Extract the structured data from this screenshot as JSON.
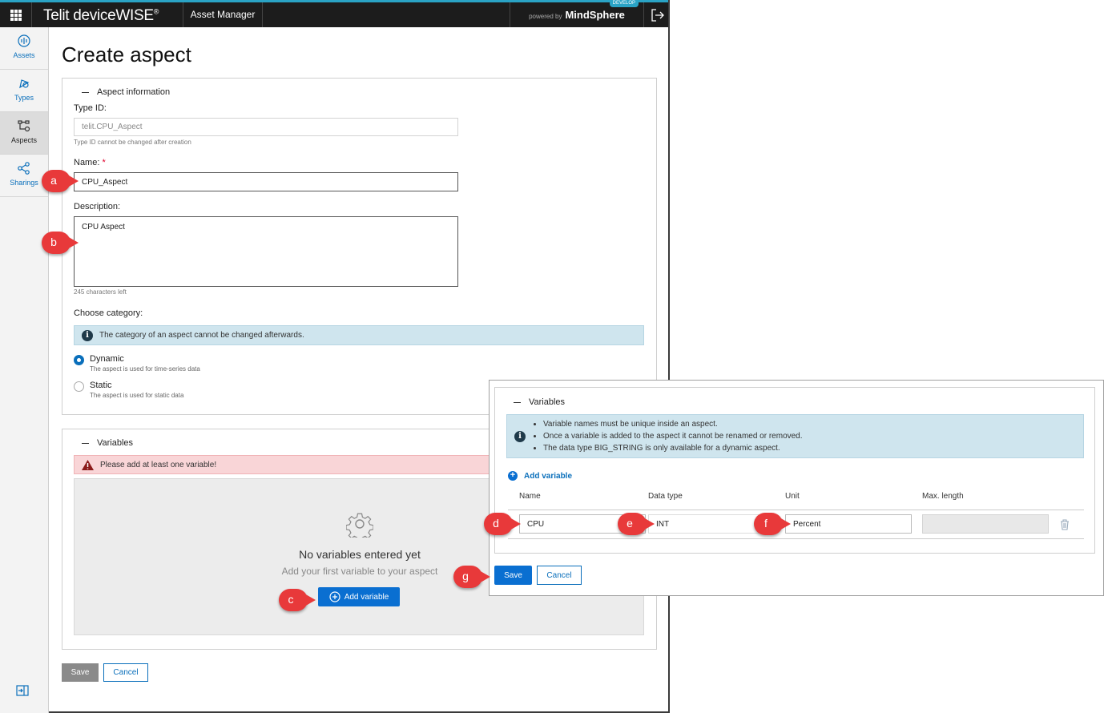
{
  "header": {
    "brand": "Telit deviceWISE",
    "app_name": "Asset Manager",
    "powered_by": "powered by",
    "platform": "MindSphere",
    "env_badge": "DEVELOP"
  },
  "sidebar": {
    "items": [
      {
        "label": "Assets",
        "icon": "assets-icon"
      },
      {
        "label": "Types",
        "icon": "types-icon"
      },
      {
        "label": "Aspects",
        "icon": "aspects-icon",
        "active": true
      },
      {
        "label": "Sharings",
        "icon": "sharings-icon"
      }
    ]
  },
  "page": {
    "title": "Create aspect"
  },
  "aspect_info": {
    "section_title": "Aspect information",
    "type_id_label": "Type ID:",
    "type_id_value": "telit.CPU_Aspect",
    "type_id_hint": "Type ID cannot be changed after creation",
    "name_label": "Name:",
    "name_required": "*",
    "name_value": "CPU_Aspect",
    "description_label": "Description:",
    "description_value": "CPU Aspect",
    "chars_left": "245 characters left",
    "category_label": "Choose category:",
    "category_info": "The category of an aspect cannot be changed afterwards.",
    "options": [
      {
        "label": "Dynamic",
        "desc": "The aspect is used for time-series data",
        "selected": true
      },
      {
        "label": "Static",
        "desc": "The aspect is used for static data",
        "selected": false
      }
    ]
  },
  "variables": {
    "section_title": "Variables",
    "error": "Please add at least one variable!",
    "empty_title": "No variables entered yet",
    "empty_subtitle": "Add your first variable to your aspect",
    "add_button": "Add variable"
  },
  "footer": {
    "save": "Save",
    "cancel": "Cancel"
  },
  "overlay": {
    "section_title": "Variables",
    "info_items": [
      "Variable names must be unique inside an aspect.",
      "Once a variable is added to the aspect it cannot be renamed or removed.",
      "The data type BIG_STRING is only available for a dynamic aspect."
    ],
    "add_link": "Add variable",
    "columns": [
      "Name",
      "Data type",
      "Unit",
      "Max. length"
    ],
    "row": {
      "name": "CPU",
      "data_type": "INT",
      "unit": "Percent",
      "max_length": ""
    },
    "save": "Save",
    "cancel": "Cancel"
  },
  "callouts": [
    "a",
    "b",
    "c",
    "d",
    "e",
    "f",
    "g"
  ],
  "colors": {
    "accent": "#0a6fd1",
    "callout": "#e8393a",
    "topbar": "#1c1c1c",
    "error_bg": "#f9d5d7",
    "info_bg": "#cfe5ee"
  }
}
